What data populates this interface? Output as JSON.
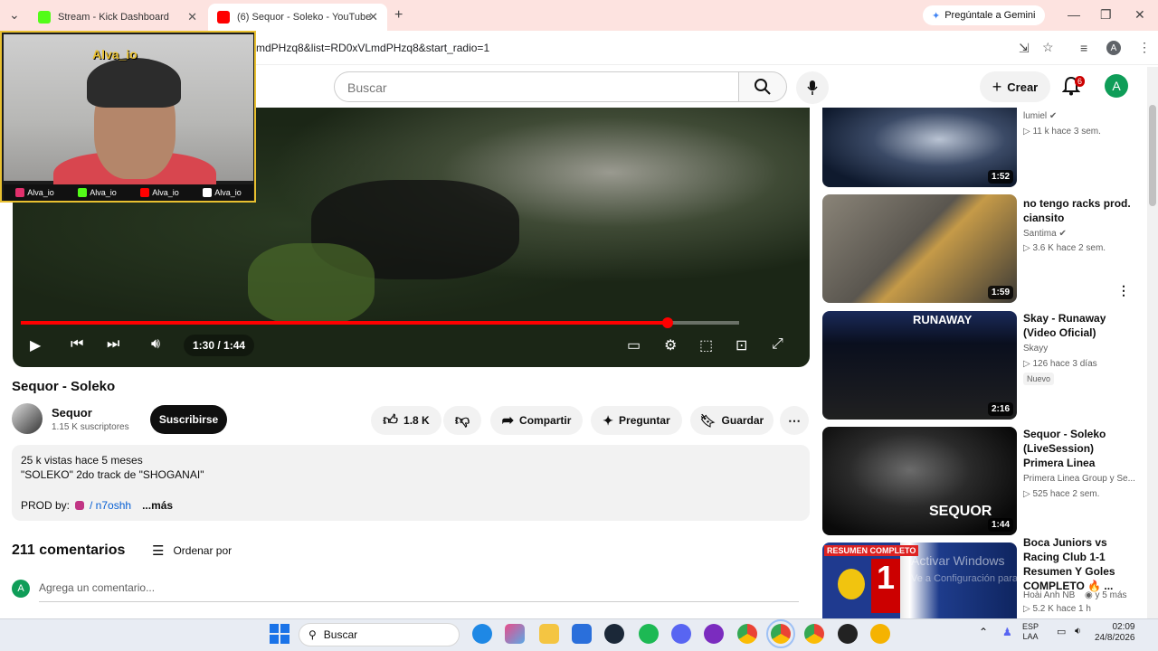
{
  "browser": {
    "tabs": [
      {
        "label": "Stream - Kick Dashboard",
        "favicon_color": "#53fc18"
      },
      {
        "label": "(6) Sequor - Soleko - YouTube",
        "favicon_color": "#ff0000"
      }
    ],
    "gemini_label": "Pregúntale a Gemini",
    "url": "mdPHzq8&list=RD0xVLmdPHzq8&start_radio=1",
    "profile_initial": "A"
  },
  "overlay": {
    "streamer": "Alva_io",
    "socials": [
      {
        "label": "Alva_io",
        "icon": "instagram-icon",
        "color": "#e1306c"
      },
      {
        "label": "Alva_io",
        "icon": "kick-icon",
        "color": "#53fc18"
      },
      {
        "label": "Alva_io",
        "icon": "youtube-icon",
        "color": "#ff0000"
      },
      {
        "label": "Alva_io",
        "icon": "tiktok-icon",
        "color": "#ffffff"
      }
    ]
  },
  "masthead": {
    "search_placeholder": "Buscar",
    "create_label": "Crear",
    "notification_count": "6",
    "avatar_initial": "A"
  },
  "player": {
    "time": "1:30 / 1:44",
    "progress": 0.9,
    "buffered": 1.0
  },
  "video": {
    "title": "Sequor - Soleko",
    "channel": "Sequor",
    "subscribers": "1.15 K suscriptores",
    "subscribe_label": "Suscribirse",
    "likes": "1.8 K",
    "share_label": "Compartir",
    "ask_label": "Preguntar",
    "save_label": "Guardar"
  },
  "description": {
    "stats": "25 k vistas  hace 5 meses",
    "line1": "\"SOLEKO\" 2do track de \"SHOGANAI\"",
    "prod_label": "PROD by:",
    "prod_handle": "/ n7oshh",
    "more_label": "...más"
  },
  "comments": {
    "count_label": "211 comentarios",
    "sort_label": "Ordenar por",
    "input_placeholder": "Agrega un comentario...",
    "avatar_initial": "A"
  },
  "recommendations": [
    {
      "title": "",
      "channel": "lumiel",
      "verified": true,
      "meta": "11 k  hace 3 sem.",
      "duration": "1:52",
      "badge": ""
    },
    {
      "title": "no tengo racks prod. ciansito",
      "channel": "Santima",
      "verified": true,
      "meta": "3.6 K  hace 2 sem.",
      "duration": "1:59",
      "badge": ""
    },
    {
      "title": "Skay - Runaway (Video Oficial)",
      "channel": "Skayy",
      "verified": false,
      "meta": "126  hace 3 días",
      "duration": "2:16",
      "badge": "Nuevo",
      "thumb_text": "RUNAWAY"
    },
    {
      "title": "Sequor - Soleko (LiveSession) Primera Linea",
      "channel": "Primera Linea Group y Se...",
      "verified": false,
      "meta": "525  hace 2 sem.",
      "duration": "1:44",
      "badge": "",
      "thumb_text": "SEQUOR"
    },
    {
      "title": "Boca Juniors vs Racing Club 1-1 Resumen Y Goles COMPLETO 🔥 ...",
      "channel": "Hoài Anh NB",
      "verified": false,
      "meta": "5.2 K  hace 1 h",
      "extra": "y 5 más",
      "duration": "",
      "badge": "",
      "thumb_text": "RESUMEN COMPLETO"
    }
  ],
  "windows": {
    "activate_title": "Activar Windows",
    "activate_sub": "Ve a Configuración para",
    "search_label": "Buscar",
    "lang": "ESP",
    "lang2": "LAA",
    "time": "02:09",
    "date": "24/8/2026"
  }
}
